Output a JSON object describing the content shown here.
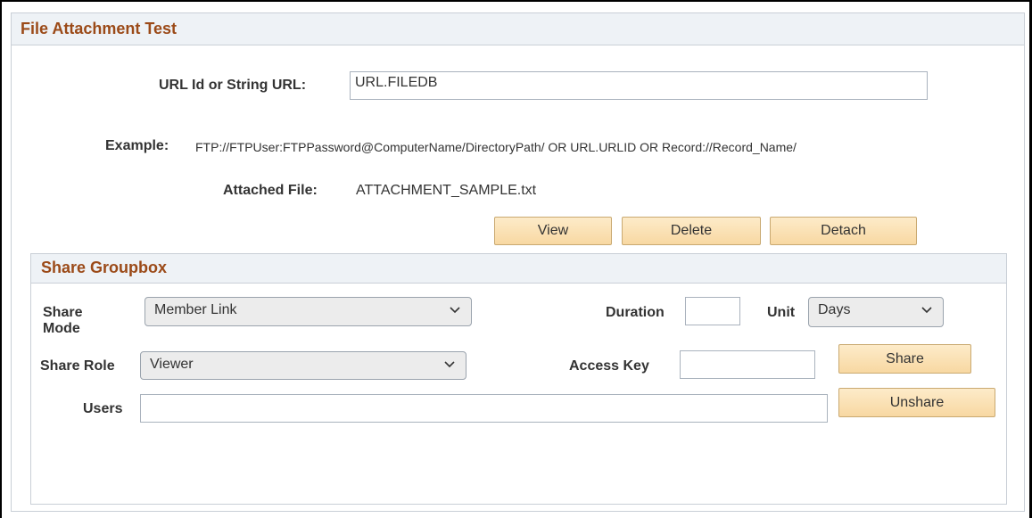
{
  "page_title": "File Attachment Test",
  "url_field": {
    "label": "URL Id or String URL:",
    "value": "URL.FILEDB"
  },
  "example": {
    "label": "Example:",
    "text": "FTP://FTPUser:FTPPassword@ComputerName/DirectoryPath/ OR URL.URLID  OR Record://Record_Name/"
  },
  "attached_file": {
    "label": "Attached File:",
    "value": "ATTACHMENT_SAMPLE.txt"
  },
  "file_buttons": {
    "view": "View",
    "delete": "Delete",
    "detach": "Detach"
  },
  "share_groupbox": {
    "title": "Share Groupbox",
    "share_mode_label_line1": "Share",
    "share_mode_label_line2": "Mode",
    "share_mode_value": "Member Link",
    "duration_label": "Duration",
    "duration_value": "",
    "unit_label": "Unit",
    "unit_value": "Days",
    "share_role_label": "Share Role",
    "share_role_value": "Viewer",
    "access_key_label": "Access Key",
    "access_key_value": "",
    "users_label": "Users",
    "users_value": "",
    "share_button": "Share",
    "unshare_button": "Unshare"
  },
  "icons": {
    "dropdown": "chevron-down-icon"
  }
}
